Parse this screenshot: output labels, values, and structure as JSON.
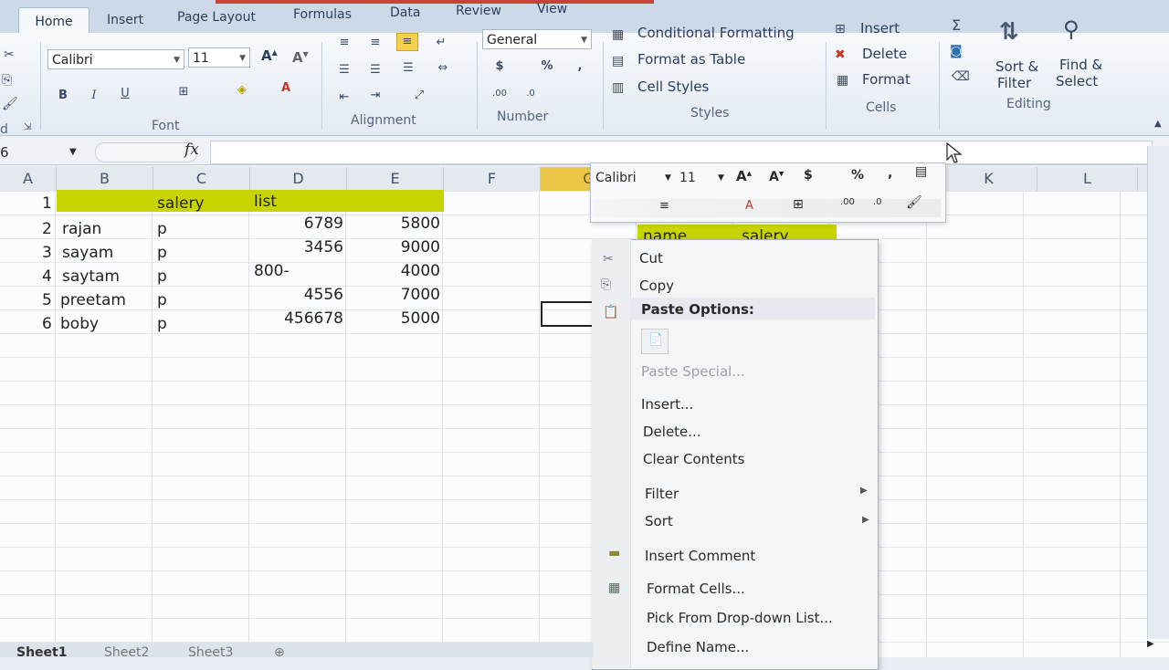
{
  "ribbon": {
    "tabs": [
      "Home",
      "Insert",
      "Page Layout",
      "Formulas",
      "Data",
      "Review",
      "View"
    ],
    "font_name": "Calibri",
    "font_size": "11",
    "number_format": "General",
    "styles": {
      "conditional_formatting": "Conditional Formatting",
      "format_as_table": "Format as Table",
      "cell_styles": "Cell Styles"
    },
    "cells": {
      "insert": "Insert",
      "delete": "Delete",
      "format": "Format"
    },
    "editing": {
      "sort_filter_1": "Sort &",
      "sort_filter_2": "Filter",
      "find_select_1": "Find &",
      "find_select_2": "Select"
    },
    "groups": {
      "font": "Font",
      "alignment": "Alignment",
      "number": "Number",
      "styles": "Styles",
      "cells": "Cells",
      "editing": "Editing"
    },
    "clipboard_label": "d"
  },
  "formula_bar": {
    "name_box": "6",
    "fx": "fx"
  },
  "grid": {
    "columns": [
      "A",
      "B",
      "C",
      "D",
      "E",
      "F",
      "G",
      "K",
      "L"
    ],
    "row_numbers": [
      "1",
      "2",
      "3",
      "4",
      "5",
      "6"
    ],
    "header_row": {
      "c": "salery",
      "d": "list"
    },
    "rows": [
      {
        "name": "rajan",
        "c": "p",
        "d": "6789",
        "e": "5800"
      },
      {
        "name": "sayam",
        "c": "p",
        "d": "3456",
        "e": "9000"
      },
      {
        "name": "saytam",
        "c": "p",
        "d": "800-",
        "e": "4000"
      },
      {
        "name": "preetam",
        "c": "p",
        "d": "4556",
        "e": "7000"
      },
      {
        "name": "boby",
        "c": "p",
        "d": "456678",
        "e": "5000"
      }
    ],
    "behind_menu": {
      "name": "name",
      "salery": "salery"
    }
  },
  "mini_toolbar": {
    "font": "Calibri",
    "size": "11"
  },
  "context_menu": {
    "cut": "Cut",
    "copy": "Copy",
    "paste_options": "Paste Options:",
    "paste_special": "Paste Special...",
    "insert": "Insert...",
    "delete": "Delete...",
    "clear_contents": "Clear Contents",
    "filter": "Filter",
    "sort": "Sort",
    "insert_comment": "Insert Comment",
    "format_cells": "Format Cells...",
    "pick_list": "Pick From Drop-down List...",
    "define_name": "Define Name..."
  },
  "sheet_tabs": [
    "Sheet1",
    "Sheet2",
    "Sheet3"
  ],
  "colors": {
    "highlight": "#c8d400",
    "ribbon": "#cdd9e8"
  }
}
